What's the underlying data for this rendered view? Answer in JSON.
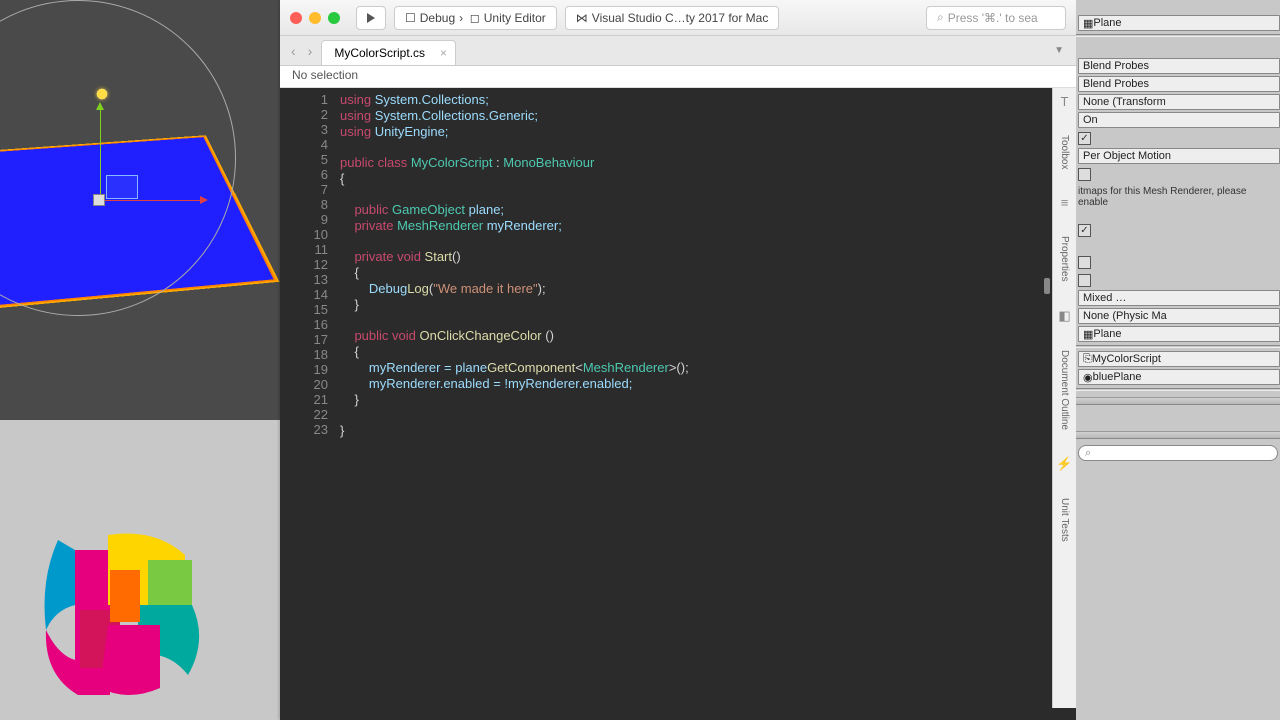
{
  "toolbar": {
    "debug_label": "Debug",
    "target_label": "Unity Editor",
    "app_label": "Visual Studio C…ty 2017 for Mac",
    "search_placeholder": "Press '⌘.' to sea"
  },
  "tabs": {
    "file": "MyColorScript.cs"
  },
  "crumb": {
    "text": "No selection"
  },
  "side_tabs": {
    "toolbox": "Toolbox",
    "properties": "Properties",
    "doc_outline": "Document Outline",
    "unit_tests": "Unit Tests"
  },
  "code": {
    "lines": [
      "1",
      "2",
      "3",
      "4",
      "5",
      "6",
      "7",
      "8",
      "9",
      "10",
      "11",
      "12",
      "13",
      "14",
      "15",
      "16",
      "17",
      "18",
      "19",
      "20",
      "21",
      "22",
      "23"
    ],
    "l1_a": "using ",
    "l1_b": "System.Collections;",
    "l2_a": "using ",
    "l2_b": "System.Collections.Generic;",
    "l3_a": "using ",
    "l3_b": "UnityEngine;",
    "l5_a": "public class ",
    "l5_b": "MyColorScript",
    "l5_c": " : ",
    "l5_d": "MonoBehaviour",
    "l6": "{",
    "l8_a": "    public ",
    "l8_b": "GameObject ",
    "l8_c": "plane;",
    "l9_a": "    private ",
    "l9_b": "MeshRenderer ",
    "l9_c": "myRenderer;",
    "l11_a": "    private void ",
    "l11_b": "Start",
    "l11_c": "()",
    "l12": "    {",
    "l13_a": "        Debug",
    ".": ".",
    "l13_b": "Log",
    "l13_c": "(",
    "l13_d": "\"We made it here\"",
    "l13_e": ");",
    "l14": "    }",
    "l16_a": "    public void ",
    "l16_b": "OnClickChangeColor ",
    "l16_c": "()",
    "l17": "    {",
    "l18_a": "        myRenderer = ",
    "l18_b": "plane",
    ".2": ".",
    "l18_c": "GetComponent",
    "l18_d": "<",
    "l18_e": "MeshRenderer",
    "l18_f": ">();",
    "l19": "        myRenderer.enabled = !myRenderer.enabled;",
    "l20": "    }",
    "l22": "}"
  },
  "inspector": {
    "plane_top": "Plane",
    "blend1": "Blend Probes",
    "blend2": "Blend Probes",
    "anchor": "None (Transform",
    "on": "On",
    "motion": "Per Object Motion",
    "lightmap_msg": "itmaps for this Mesh Renderer, please enable",
    "tag": "Mixed …",
    "physmat": "None (Physic Ma",
    "mesh": "Plane",
    "script": "MyColorScript",
    "plane_ref": "bluePlane"
  }
}
